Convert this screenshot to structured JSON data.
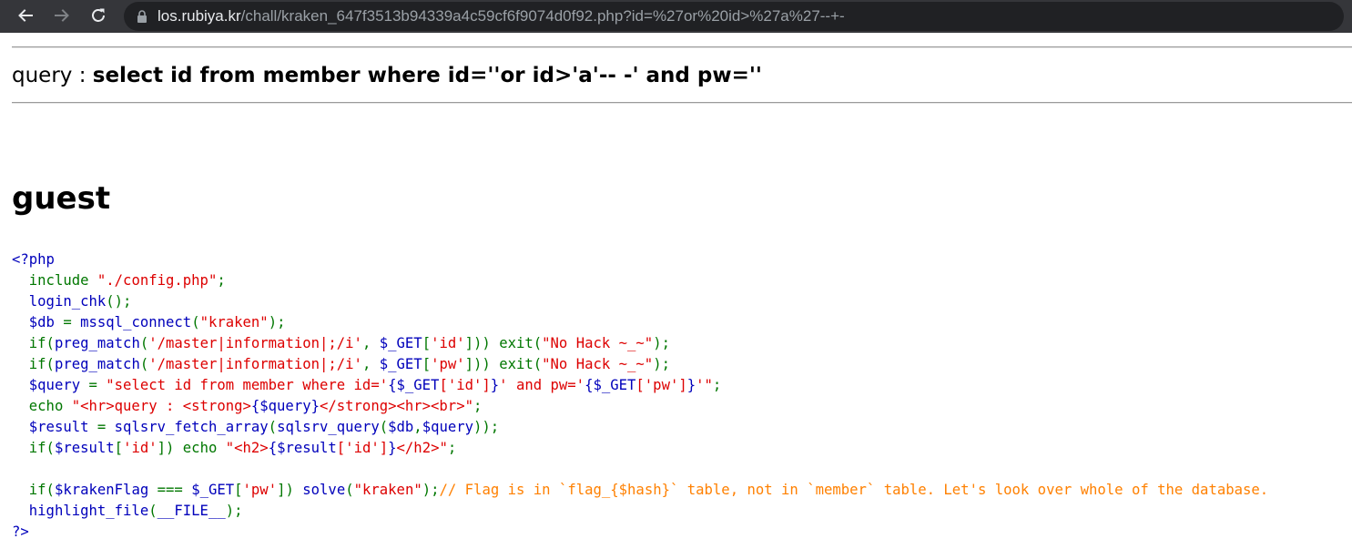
{
  "browser": {
    "url_host": "los.rubiya.kr",
    "url_path": "/chall/kraken_647f3513b94339a4c59cf6f9074d0f92.php?id=%27or%20id>%27a%27--+-"
  },
  "query": {
    "label": "query : ",
    "value": "select id from member where id=''or id>'a'-- -' and pw=''"
  },
  "result": {
    "id": "guest"
  },
  "source_lines": [
    [
      {
        "t": "def",
        "v": "<?php"
      }
    ],
    [
      {
        "t": "def",
        "v": "  "
      },
      {
        "t": "kw",
        "v": "include "
      },
      {
        "t": "str",
        "v": "\"./config.php\""
      },
      {
        "t": "kw",
        "v": ";"
      }
    ],
    [
      {
        "t": "def",
        "v": "  login_chk"
      },
      {
        "t": "kw",
        "v": "();"
      }
    ],
    [
      {
        "t": "def",
        "v": "  $db "
      },
      {
        "t": "kw",
        "v": "= "
      },
      {
        "t": "def",
        "v": "mssql_connect"
      },
      {
        "t": "kw",
        "v": "("
      },
      {
        "t": "str",
        "v": "\"kraken\""
      },
      {
        "t": "kw",
        "v": ");"
      }
    ],
    [
      {
        "t": "def",
        "v": "  "
      },
      {
        "t": "kw",
        "v": "if("
      },
      {
        "t": "def",
        "v": "preg_match"
      },
      {
        "t": "kw",
        "v": "("
      },
      {
        "t": "str",
        "v": "'/master|information|;/i'"
      },
      {
        "t": "kw",
        "v": ", "
      },
      {
        "t": "def",
        "v": "$_GET"
      },
      {
        "t": "kw",
        "v": "["
      },
      {
        "t": "str",
        "v": "'id'"
      },
      {
        "t": "kw",
        "v": "])) exit("
      },
      {
        "t": "str",
        "v": "\"No Hack ~_~\""
      },
      {
        "t": "kw",
        "v": ");"
      }
    ],
    [
      {
        "t": "def",
        "v": "  "
      },
      {
        "t": "kw",
        "v": "if("
      },
      {
        "t": "def",
        "v": "preg_match"
      },
      {
        "t": "kw",
        "v": "("
      },
      {
        "t": "str",
        "v": "'/master|information|;/i'"
      },
      {
        "t": "kw",
        "v": ", "
      },
      {
        "t": "def",
        "v": "$_GET"
      },
      {
        "t": "kw",
        "v": "["
      },
      {
        "t": "str",
        "v": "'pw'"
      },
      {
        "t": "kw",
        "v": "])) exit("
      },
      {
        "t": "str",
        "v": "\"No Hack ~_~\""
      },
      {
        "t": "kw",
        "v": ");"
      }
    ],
    [
      {
        "t": "def",
        "v": "  $query "
      },
      {
        "t": "kw",
        "v": "= "
      },
      {
        "t": "str",
        "v": "\"select id from member where id='"
      },
      {
        "t": "def",
        "v": "{$_GET"
      },
      {
        "t": "str",
        "v": "['id']"
      },
      {
        "t": "def",
        "v": "}"
      },
      {
        "t": "str",
        "v": "' and pw='"
      },
      {
        "t": "def",
        "v": "{$_GET"
      },
      {
        "t": "str",
        "v": "['pw']"
      },
      {
        "t": "def",
        "v": "}"
      },
      {
        "t": "str",
        "v": "'\""
      },
      {
        "t": "kw",
        "v": ";"
      }
    ],
    [
      {
        "t": "kw",
        "v": "  echo "
      },
      {
        "t": "str",
        "v": "\"<hr>query : <strong>"
      },
      {
        "t": "def",
        "v": "{$query}"
      },
      {
        "t": "str",
        "v": "</strong><hr><br>\""
      },
      {
        "t": "kw",
        "v": ";"
      }
    ],
    [
      {
        "t": "def",
        "v": "  $result "
      },
      {
        "t": "kw",
        "v": "= "
      },
      {
        "t": "def",
        "v": "sqlsrv_fetch_array"
      },
      {
        "t": "kw",
        "v": "("
      },
      {
        "t": "def",
        "v": "sqlsrv_query"
      },
      {
        "t": "kw",
        "v": "("
      },
      {
        "t": "def",
        "v": "$db"
      },
      {
        "t": "kw",
        "v": ","
      },
      {
        "t": "def",
        "v": "$query"
      },
      {
        "t": "kw",
        "v": "));"
      }
    ],
    [
      {
        "t": "def",
        "v": "  "
      },
      {
        "t": "kw",
        "v": "if("
      },
      {
        "t": "def",
        "v": "$result"
      },
      {
        "t": "kw",
        "v": "["
      },
      {
        "t": "str",
        "v": "'id'"
      },
      {
        "t": "kw",
        "v": "]) echo "
      },
      {
        "t": "str",
        "v": "\"<h2>"
      },
      {
        "t": "def",
        "v": "{$result"
      },
      {
        "t": "str",
        "v": "['id']"
      },
      {
        "t": "def",
        "v": "}"
      },
      {
        "t": "str",
        "v": "</h2>\""
      },
      {
        "t": "kw",
        "v": ";"
      }
    ],
    [
      {
        "t": "def",
        "v": " "
      }
    ],
    [
      {
        "t": "def",
        "v": "  "
      },
      {
        "t": "kw",
        "v": "if("
      },
      {
        "t": "def",
        "v": "$krakenFlag "
      },
      {
        "t": "kw",
        "v": "=== "
      },
      {
        "t": "def",
        "v": "$_GET"
      },
      {
        "t": "kw",
        "v": "["
      },
      {
        "t": "str",
        "v": "'pw'"
      },
      {
        "t": "kw",
        "v": "]) "
      },
      {
        "t": "def",
        "v": "solve"
      },
      {
        "t": "kw",
        "v": "("
      },
      {
        "t": "str",
        "v": "\"kraken\""
      },
      {
        "t": "kw",
        "v": ");"
      },
      {
        "t": "cmt",
        "v": "// Flag is in `flag_{$hash}` table, not in `member` table. Let's look over whole of the database."
      }
    ],
    [
      {
        "t": "def",
        "v": "  highlight_file"
      },
      {
        "t": "kw",
        "v": "("
      },
      {
        "t": "def",
        "v": "__FILE__"
      },
      {
        "t": "kw",
        "v": ");"
      }
    ],
    [
      {
        "t": "def",
        "v": "?>"
      }
    ]
  ],
  "colors": {
    "toolbar_bg": "#35363a",
    "omnibox_bg": "#202124",
    "php_default": "#0000bb",
    "php_keyword": "#007700",
    "php_string": "#dd0000",
    "php_comment": "#ff8000"
  }
}
